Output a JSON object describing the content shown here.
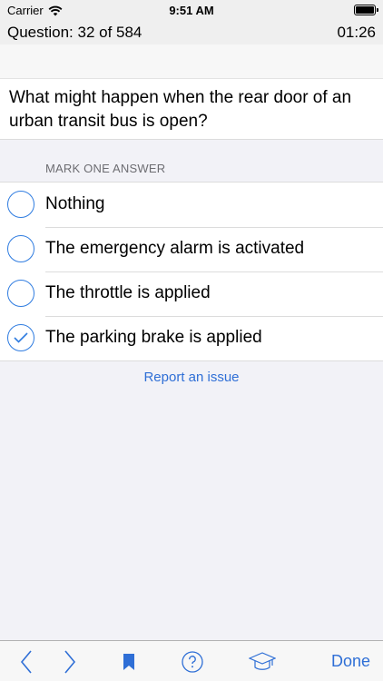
{
  "status_bar": {
    "carrier": "Carrier",
    "time": "9:51 AM"
  },
  "header": {
    "question_count": "Question: 32 of 584",
    "timer": "01:26"
  },
  "question": {
    "text": "What might happen when the rear door of an urban transit bus is open?"
  },
  "answers": {
    "section_label": "MARK ONE ANSWER",
    "options": [
      {
        "label": "Nothing",
        "selected": false
      },
      {
        "label": "The emergency alarm is activated",
        "selected": false
      },
      {
        "label": "The throttle is applied",
        "selected": false
      },
      {
        "label": "The parking brake is applied",
        "selected": true
      }
    ]
  },
  "report_link": "Report an issue",
  "toolbar": {
    "done_label": "Done",
    "icons": [
      "back-icon",
      "forward-icon",
      "bookmark-icon",
      "help-icon",
      "graduation-cap-icon"
    ]
  },
  "colors": {
    "accent": "#2f7ce0",
    "link": "#2f6fd6"
  }
}
